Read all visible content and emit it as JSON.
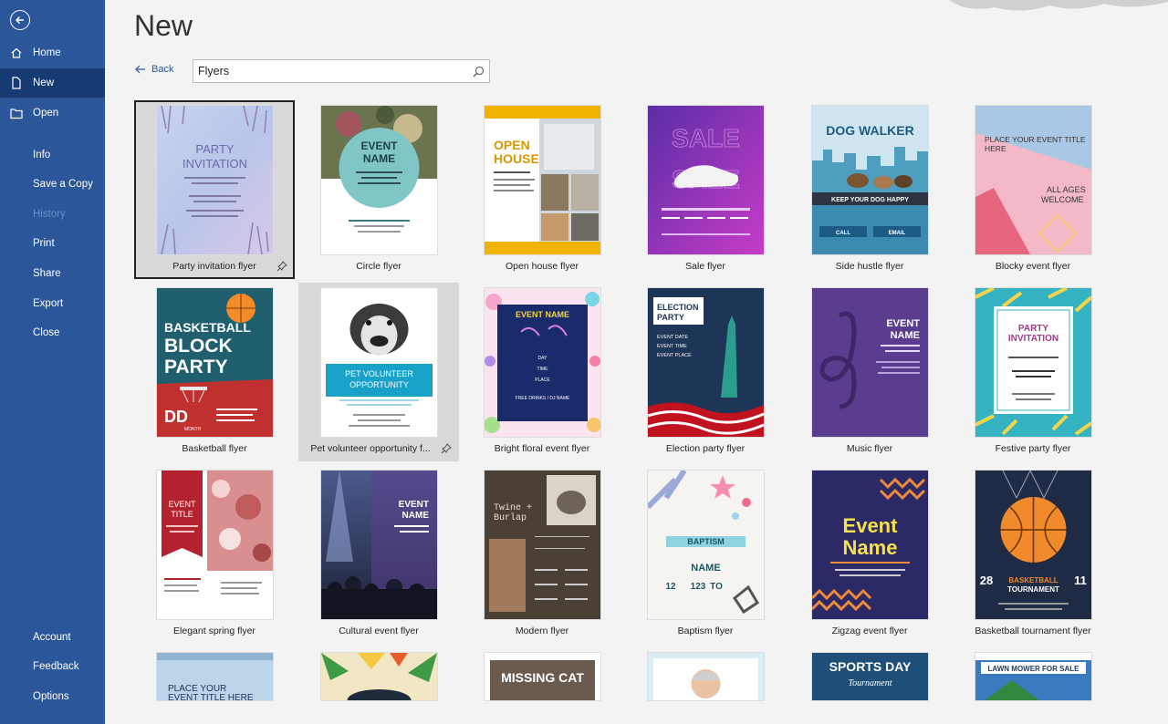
{
  "sidebar": {
    "items": [
      {
        "key": "home",
        "label": "Home"
      },
      {
        "key": "new",
        "label": "New"
      },
      {
        "key": "open",
        "label": "Open"
      },
      {
        "key": "info",
        "label": "Info"
      },
      {
        "key": "save_copy",
        "label": "Save a Copy"
      },
      {
        "key": "history",
        "label": "History"
      },
      {
        "key": "print",
        "label": "Print"
      },
      {
        "key": "share",
        "label": "Share"
      },
      {
        "key": "export",
        "label": "Export"
      },
      {
        "key": "close",
        "label": "Close"
      },
      {
        "key": "account",
        "label": "Account"
      },
      {
        "key": "feedback",
        "label": "Feedback"
      },
      {
        "key": "options",
        "label": "Options"
      }
    ]
  },
  "header": {
    "title": "New",
    "back_label": "Back"
  },
  "search": {
    "value": "Flyers"
  },
  "templates": [
    {
      "name": "Party invitation flyer",
      "thumb_text": [
        "PARTY",
        "INVITATION"
      ]
    },
    {
      "name": "Circle flyer",
      "thumb_text": [
        "EVENT",
        "NAME"
      ]
    },
    {
      "name": "Open house flyer",
      "thumb_text": [
        "OPEN",
        "HOUSE"
      ]
    },
    {
      "name": "Sale flyer",
      "thumb_text": [
        "SALE"
      ]
    },
    {
      "name": "Side hustle flyer",
      "thumb_text": [
        "DOG WALKER",
        "KEEP YOUR DOG HAPPY",
        "CALL",
        "EMAIL"
      ]
    },
    {
      "name": "Blocky event flyer",
      "thumb_text": [
        "PLACE YOUR EVENT TITLE HERE",
        "ALL AGES",
        "WELCOME"
      ]
    },
    {
      "name": "Basketball flyer",
      "thumb_text": [
        "BASKETBALL",
        "BLOCK",
        "PARTY",
        "DD",
        "MONTH"
      ]
    },
    {
      "name": "Pet volunteer opportunity f...",
      "thumb_text": [
        "PET VOLUNTEER",
        "OPPORTUNITY"
      ]
    },
    {
      "name": "Bright floral event flyer",
      "thumb_text": [
        "EVENT NAME",
        "DAY",
        "TIME",
        "PLACE",
        "FREE DRINKS / DJ NAME"
      ]
    },
    {
      "name": "Election party flyer",
      "thumb_text": [
        "ELECTION",
        "PARTY",
        "EVENT DATE",
        "EVENT TIME",
        "EVENT PLACE"
      ]
    },
    {
      "name": "Music flyer",
      "thumb_text": [
        "EVENT",
        "NAME"
      ]
    },
    {
      "name": "Festive party flyer",
      "thumb_text": [
        "PARTY",
        "INVITATION"
      ]
    },
    {
      "name": "Elegant spring flyer",
      "thumb_text": [
        "EVENT",
        "TITLE"
      ]
    },
    {
      "name": "Cultural event flyer",
      "thumb_text": [
        "EVENT",
        "NAME"
      ]
    },
    {
      "name": "Modern flyer",
      "thumb_text": [
        "Twine +",
        "Burlap"
      ]
    },
    {
      "name": "Baptism flyer",
      "thumb_text": [
        "BAPTISM",
        "NAME",
        "12",
        "123",
        "TO"
      ]
    },
    {
      "name": "Zigzag event flyer",
      "thumb_text": [
        "Event",
        "Name"
      ]
    },
    {
      "name": "Basketball tournament flyer",
      "thumb_text": [
        "28",
        "BASKETBALL",
        "TOURNAMENT",
        "11"
      ]
    },
    {
      "name": "",
      "thumb_text": [
        "PLACE YOUR",
        "EVENT TITLE HERE"
      ]
    },
    {
      "name": "",
      "thumb_text": []
    },
    {
      "name": "",
      "thumb_text": [
        "MISSING CAT"
      ]
    },
    {
      "name": "",
      "thumb_text": []
    },
    {
      "name": "",
      "thumb_text": [
        "SPORTS DAY",
        "Tournament"
      ]
    },
    {
      "name": "",
      "thumb_text": [
        "LAWN MOWER FOR SALE"
      ]
    }
  ],
  "colors": {
    "sidebar_bg": "#2b579a",
    "sidebar_active": "#163b73",
    "accent": "#2b579a"
  }
}
